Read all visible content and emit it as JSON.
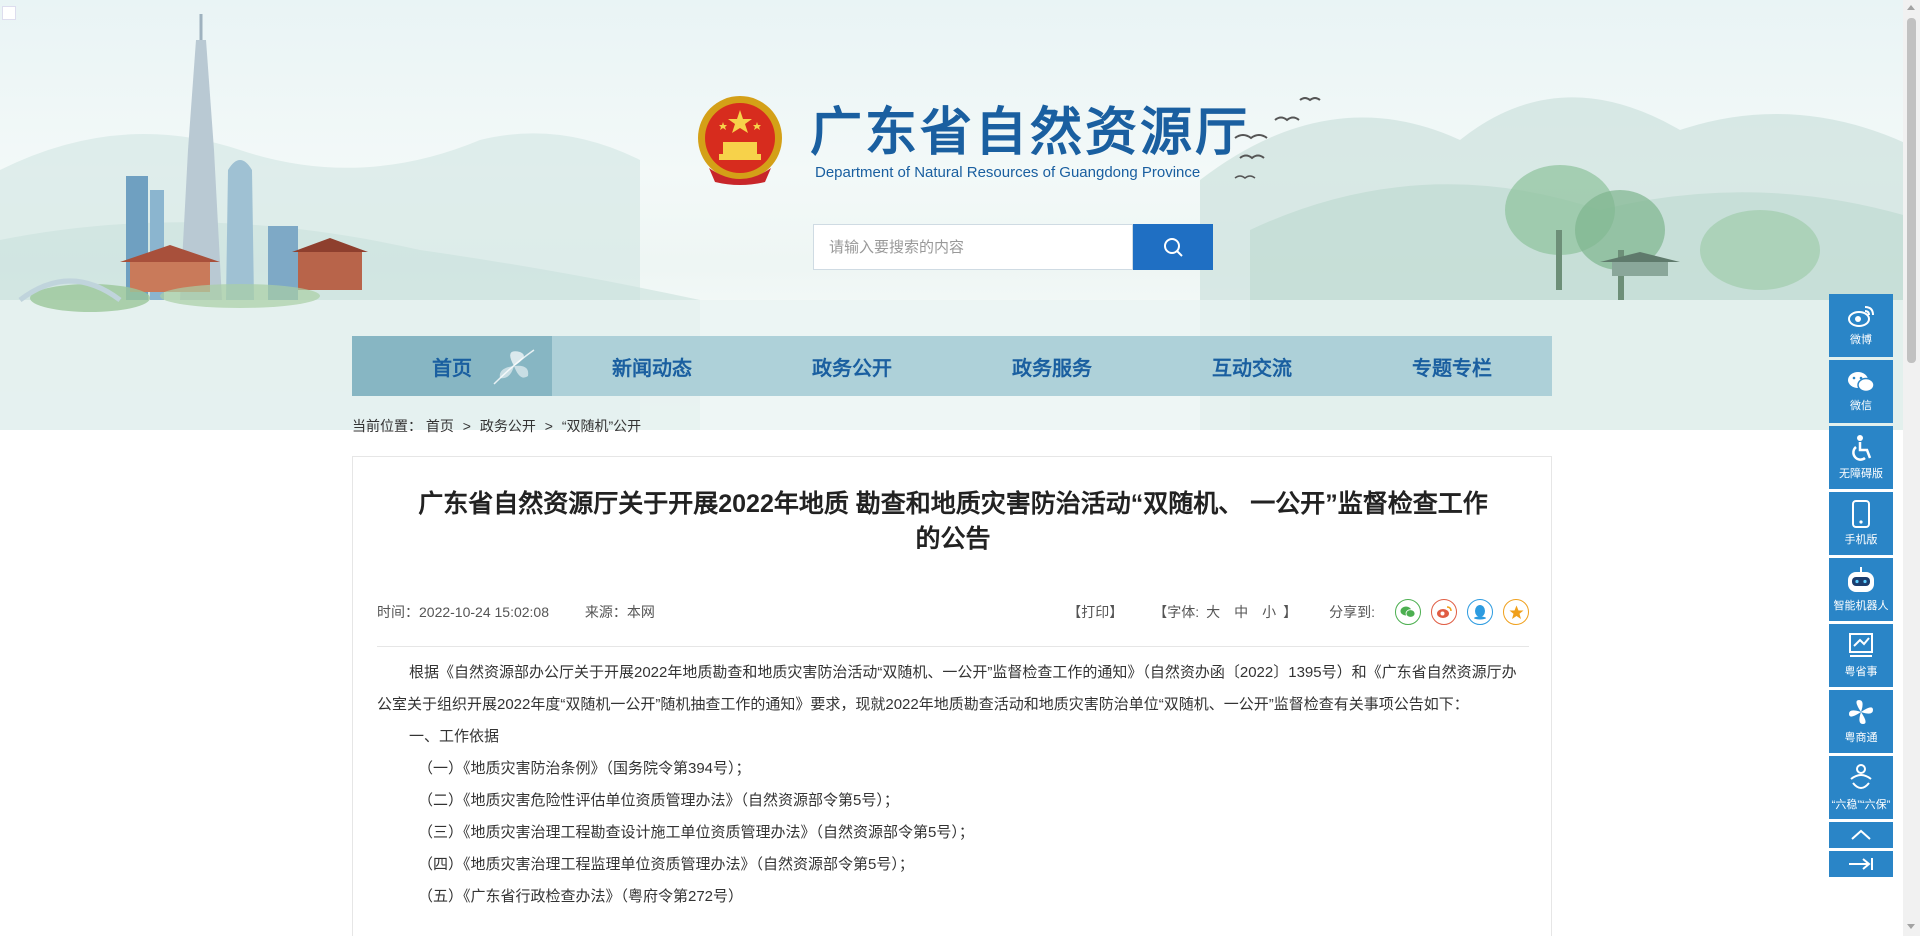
{
  "header": {
    "title": "广东省自然资源厅",
    "subtitle": "Department of Natural Resources of Guangdong Province"
  },
  "search": {
    "placeholder": "请输入要搜索的内容",
    "button_icon": "search-icon"
  },
  "nav": {
    "items": [
      {
        "label": "首页"
      },
      {
        "label": "新闻动态"
      },
      {
        "label": "政务公开"
      },
      {
        "label": "政务服务"
      },
      {
        "label": "互动交流"
      },
      {
        "label": "专题专栏"
      }
    ]
  },
  "breadcrumb": {
    "prefix": "当前位置：",
    "items": [
      "首页",
      "政务公开",
      "“双随机”公开"
    ],
    "separator": ">"
  },
  "article": {
    "title_line1": "广东省自然资源厅关于开展2022年地质 勘查和地质灾害防治活动“双随机、 一公开”监督检查工作",
    "title_line2": "的公告",
    "time": "时间：2022-10-24 15:02:08",
    "source": "来源：本网",
    "print": "【打印】",
    "font_label": "【字体:",
    "font_large": "大",
    "font_medium": "中",
    "font_small": "小",
    "font_close": "】",
    "share_label": "分享到:",
    "paragraphs": {
      "intro": "根据《自然资源部办公厅关于开展2022年地质勘查和地质灾害防治活动“双随机、一公开”监督检查工作的通知》（自然资办函〔2022〕1395号）和《广东省自然资源厅办公室关于组织开展2022年度“双随机一公开”随机抽查工作的通知》要求，现就2022年地质勘查活动和地质灾害防治单位“双随机、一公开”监督检查有关事项公告如下：",
      "section1": "一、工作依据",
      "item1": "（一）《地质灾害防治条例》（国务院令第394号）；",
      "item2": "（二）《地质灾害危险性评估单位资质管理办法》（自然资源部令第5号）；",
      "item3": "（三）《地质灾害治理工程勘查设计施工单位资质管理办法》（自然资源部令第5号）；",
      "item4": "（四）《地质灾害治理工程监理单位资质管理办法》（自然资源部令第5号）；",
      "item5": "（五）《广东省行政检查办法》（粤府令第272号）"
    }
  },
  "float_bar": {
    "items": [
      {
        "label": "微博",
        "icon": "weibo-icon"
      },
      {
        "label": "微信",
        "icon": "wechat-icon"
      },
      {
        "label": "无障碍版",
        "icon": "accessibility-icon"
      },
      {
        "label": "手机版",
        "icon": "mobile-icon"
      },
      {
        "label": "智能机器人",
        "icon": "robot-icon"
      },
      {
        "label": "粤省事",
        "icon": "yueshengshi-icon"
      },
      {
        "label": "粤商通",
        "icon": "yueshangtong-icon"
      },
      {
        "label": "“六稳”“六保”",
        "icon": "liuwen-liubao-icon"
      }
    ]
  },
  "colors": {
    "brand_blue": "#1a5fa0",
    "button_blue": "#1f6fc3",
    "float_blue": "#2a85c7",
    "nav_bg": "#a8cdd6",
    "share_wechat": "#4caf50",
    "share_weibo": "#e05d44",
    "share_qq": "#2c9be0",
    "share_favorite": "#f0a01c"
  }
}
